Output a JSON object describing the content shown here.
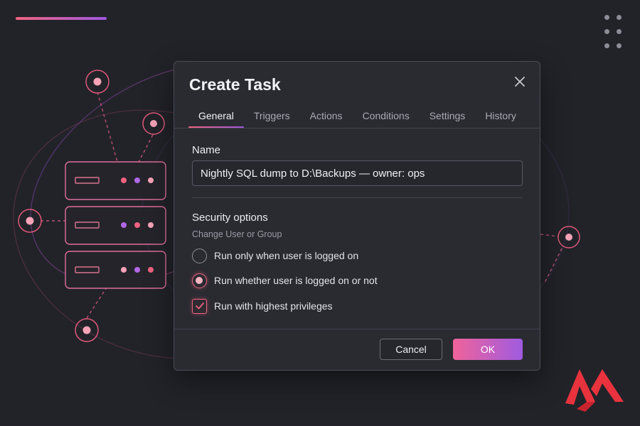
{
  "dialog": {
    "title": "Create Task",
    "tabs": [
      {
        "label": "General",
        "active": true
      },
      {
        "label": "Triggers",
        "active": false
      },
      {
        "label": "Actions",
        "active": false
      },
      {
        "label": "Conditions",
        "active": false
      },
      {
        "label": "Settings",
        "active": false
      },
      {
        "label": "History",
        "active": false
      }
    ],
    "name_label": "Name",
    "name_value": "Nightly SQL dump to D:\\Backups — owner: ops",
    "security": {
      "title": "Security options",
      "subtitle": "Change User or Group",
      "options": [
        {
          "label": "Run only when user is logged on",
          "type": "radio",
          "checked": false
        },
        {
          "label": "Run whether user is logged on or not",
          "type": "radio",
          "checked": true
        },
        {
          "label": "Run with highest privileges",
          "type": "checkbox",
          "checked": true
        }
      ]
    },
    "buttons": {
      "cancel": "Cancel",
      "ok": "OK"
    }
  },
  "icons": {
    "close": "close-icon",
    "check": "checkmark-icon",
    "logo": "brand-logo"
  },
  "colors": {
    "background": "#222329",
    "dialog": "#2a2b31",
    "accent_pink": "#f0637f",
    "accent_purple": "#a058e0"
  }
}
